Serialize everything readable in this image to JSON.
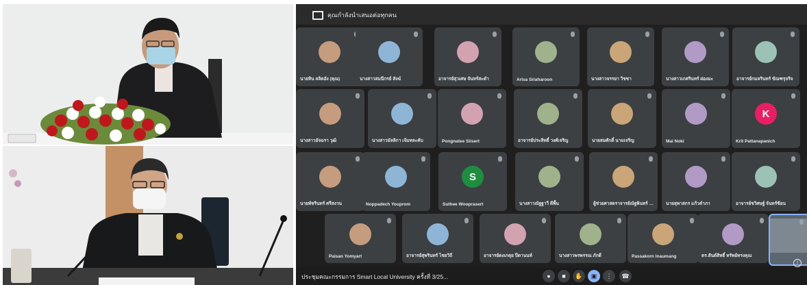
{
  "meeting": {
    "presenting_banner": "คุณกำลังนำเสนอต่อทุกคน",
    "title": "ประชุมคณะกรรมการ Smart Local University ครั้งที่ 3/25...",
    "participants": [
      {
        "name": "นายทิน ลลิตอัง (คุณ)",
        "avatar": "photo"
      },
      {
        "name": "นางสาวสมนึกรย์ สังฆ์",
        "avatar": "photo"
      },
      {
        "name": "อาจารย์สุวเศษ จันทร์สะดำ",
        "avatar": "photo"
      },
      {
        "name": "Arisa Sriaharoon",
        "avatar": "photo"
      },
      {
        "name": "นางสาวจรรยา วิชชา",
        "avatar": "photo"
      },
      {
        "name": "นางสาวเกศรินทร์ ผ่องมะ",
        "avatar": "photo"
      },
      {
        "name": "อาจารย์กมลรินทร์ ขัณฑรุจริจ",
        "avatar": "photo"
      },
      {
        "name": "นางสาวอัจฉรา วุฒิ",
        "avatar": "photo"
      },
      {
        "name": "นางสาวมัลลิกา เจ้มหละคับ",
        "avatar": "photo"
      },
      {
        "name": "Pongnatee Siisert",
        "avatar": "photo"
      },
      {
        "name": "อาจารย์ประสิทธิ์ วงศ์เจริญ",
        "avatar": "photo"
      },
      {
        "name": "นายสมศักดิ์ นามเจริญ",
        "avatar": "photo"
      },
      {
        "name": "Mai Noki",
        "avatar": "photo"
      },
      {
        "name": "Krit Pattanapanich",
        "avatar": "letter",
        "letter": "K",
        "color": "#e91e63"
      },
      {
        "name": "นายพัชรินทร์ ศรีสงวน",
        "avatar": "photo"
      },
      {
        "name": "Noppadech Youprom",
        "avatar": "photo"
      },
      {
        "name": "Suthee Wooprasert",
        "avatar": "letter",
        "letter": "S",
        "color": "#1e8e3e"
      },
      {
        "name": "นางสาวณัฐฐาวี ดีพื้น",
        "avatar": "photo"
      },
      {
        "name": "ผู้ช่วยศาสตราจารย์ณัฐพินทร์ โล...",
        "avatar": "photo"
      },
      {
        "name": "นายสุพาสกร แก้วคำภา",
        "avatar": "photo"
      },
      {
        "name": "อาจารย์ชวิศษฐ์ จันทร์ซ้อน",
        "avatar": "photo"
      },
      {
        "name": "Paisan Yomyart",
        "avatar": "photo"
      },
      {
        "name": "อาจารย์สุพรินทร์ ไชยวิถี",
        "avatar": "photo"
      },
      {
        "name": "อาจารย์ดงเกตุย ปีดานนท์",
        "avatar": "photo"
      },
      {
        "name": "นางสาวพรพรรณ ภักดี",
        "avatar": "photo"
      },
      {
        "name": "Passakorn Inaumang",
        "avatar": "photo"
      },
      {
        "name": "ดร.สันต์สิทธิ์ ทรัพย์ทรงคุณ",
        "avatar": "photo"
      },
      {
        "name": "",
        "avatar": "room"
      }
    ],
    "controls": [
      {
        "id": "mic",
        "glyph": "●"
      },
      {
        "id": "camera",
        "glyph": "■"
      },
      {
        "id": "raise-hand",
        "glyph": "✋"
      },
      {
        "id": "present",
        "glyph": "▣"
      },
      {
        "id": "more",
        "glyph": "⋮"
      },
      {
        "id": "end-call",
        "glyph": "☎"
      }
    ]
  }
}
